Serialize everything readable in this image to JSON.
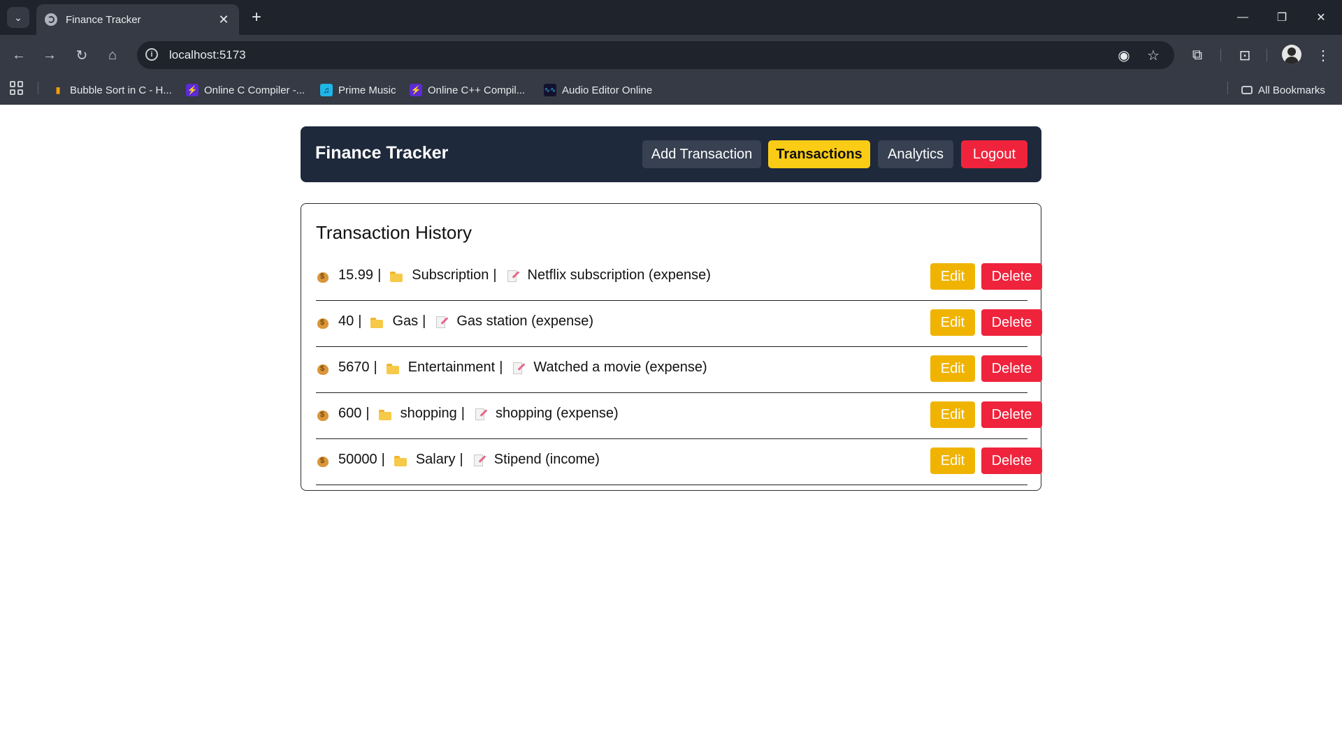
{
  "browser": {
    "tab_title": "Finance Tracker",
    "url": "localhost:5173",
    "bookmarks": [
      {
        "label": "Bubble Sort in C - H...",
        "icon": "bar-chart-icon",
        "color": "#f59e0b"
      },
      {
        "label": "Online C Compiler -...",
        "icon": "bolt-icon",
        "color": "#7c3aed"
      },
      {
        "label": "Prime Music",
        "icon": "music-icon",
        "color": "#1fb6e9"
      },
      {
        "label": "Online C++ Compil...",
        "icon": "bolt-icon",
        "color": "#7c3aed"
      },
      {
        "label": "Audio Editor Online",
        "icon": "waveform-icon",
        "color": "#1b1b3a"
      }
    ],
    "all_bookmarks_label": "All Bookmarks"
  },
  "app": {
    "brand": "Finance Tracker",
    "nav": {
      "add_transaction": "Add Transaction",
      "transactions": "Transactions",
      "analytics": "Analytics",
      "logout": "Logout"
    },
    "colors": {
      "navbar": "#1e293b",
      "active": "#facc15",
      "edit": "#f0b400",
      "delete": "#ef233c"
    }
  },
  "history": {
    "title": "Transaction History",
    "separator": "|",
    "edit_label": "Edit",
    "delete_label": "Delete",
    "transactions": [
      {
        "amount": "15.99",
        "category": "Subscription",
        "note": "Netflix subscription (expense)"
      },
      {
        "amount": "40",
        "category": "Gas",
        "note": "Gas station (expense)"
      },
      {
        "amount": "5670",
        "category": "Entertainment",
        "note": "Watched a movie (expense)"
      },
      {
        "amount": "600",
        "category": "shopping",
        "note": "shopping (expense)"
      },
      {
        "amount": "50000",
        "category": "Salary",
        "note": "Stipend (income)"
      }
    ]
  }
}
